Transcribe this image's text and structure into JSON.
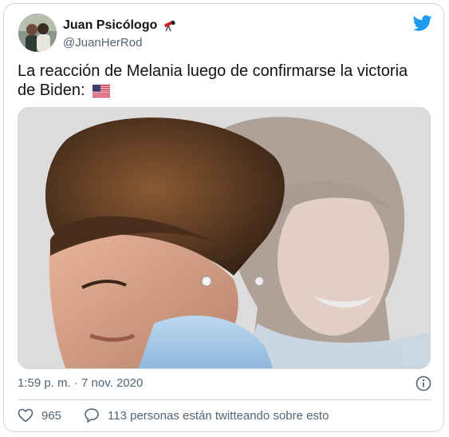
{
  "tweet": {
    "display_name": "Juan Psicólogo",
    "handle": "@JuanHerRod",
    "text": "La reacción de Melania luego de confirmarse la victoria de Biden:",
    "flag_emoji": "us-flag",
    "timestamp": "1:59 p. m. · 7 nov. 2020",
    "likes": "965",
    "conversation": "113 personas están twitteando sobre esto"
  },
  "icons": {
    "telescope": "telescope-icon",
    "twitter": "twitter-bird-icon",
    "info": "info-icon",
    "heart": "heart-icon",
    "reply": "speech-bubble-icon"
  },
  "colors": {
    "brand": "#1d9bf0",
    "text": "#0f1419",
    "muted": "#536471",
    "border": "#cfd9de"
  }
}
